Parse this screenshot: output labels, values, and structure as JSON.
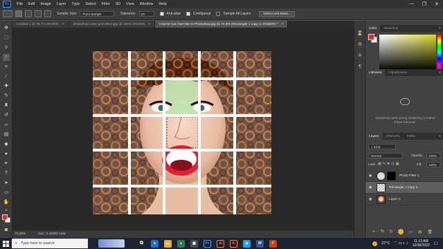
{
  "app": {
    "logo": "Ps",
    "menu": [
      "File",
      "Edit",
      "Image",
      "Layer",
      "Type",
      "Select",
      "Filter",
      "3D",
      "View",
      "Window",
      "Help"
    ],
    "window_controls": [
      "—",
      "❐",
      "✕"
    ]
  },
  "options_bar": {
    "sample_size_label": "Sample Size:",
    "sample_size_value": "Point Sample",
    "tolerance_label": "Tolerance:",
    "tolerance_value": "10",
    "anti_alias_label": "Anti-alias",
    "contiguous_label": "Contiguous",
    "sample_all_layers_label": "Sample All Layers",
    "select_and_mask_label": "Select and Mask..."
  },
  "tabs": [
    {
      "title": "Untitled-1 @ 16.7% (RGB/8)",
      "active": false
    },
    {
      "title": "photoshop-color-grid-effect.jpg @ 100% (RGB/8)",
      "active": false
    },
    {
      "title": "How-to-Cut-Out-Hair-in-Photoshop.jpg @ 74.6% (Rectangle 1 copy 3, RGB/8#) *",
      "active": true
    }
  ],
  "tab_close": "×",
  "status": {
    "zoom": "74.66%",
    "doc": "Doc: 3.42M/2.14M"
  },
  "panels": {
    "color_tabs": [
      "Color",
      "Swatches"
    ],
    "libraries_tabs": [
      "Libraries",
      "Adjustments"
    ],
    "libraries_message": "Something went wrong initializing Creative Cloud Libraries",
    "layers_tabs": [
      "Layers",
      "Channels",
      "Paths"
    ],
    "kind_label": "Kind",
    "blend_mode": "Normal",
    "opacity_label": "Opacity:",
    "opacity_value": "100%",
    "lock_label": "Lock:",
    "fill_label": "Fill:",
    "fill_value": "100%",
    "layers": [
      {
        "name": "Photo Filter 1",
        "selected": false
      },
      {
        "name": "Rectangle 1 copy 3",
        "selected": true
      },
      {
        "name": "Layer 0",
        "selected": false
      }
    ]
  },
  "colors": {
    "foreground": "#ff2020",
    "background": "#ffffff",
    "picker_hue": "#c8c832"
  },
  "taskbar": {
    "search_placeholder": "Type here to search",
    "apps": [
      "Ps",
      "Ai",
      "Ai"
    ],
    "temperature": "27°C",
    "time": "11:13 AM",
    "date": "10/30/2022"
  },
  "icons": {
    "eye": "eye-icon",
    "tools": [
      "move-tool-icon",
      "marquee-tool-icon",
      "lasso-tool-icon",
      "magic-wand-tool-icon",
      "crop-tool-icon",
      "eyedropper-tool-icon",
      "healing-brush-icon",
      "brush-tool-icon",
      "clone-stamp-icon",
      "history-brush-icon",
      "eraser-tool-icon",
      "gradient-tool-icon",
      "blur-tool-icon",
      "dodge-tool-icon",
      "pen-tool-icon",
      "type-tool-icon",
      "path-select-icon",
      "rectangle-tool-icon",
      "hand-tool-icon",
      "zoom-tool-icon"
    ]
  }
}
